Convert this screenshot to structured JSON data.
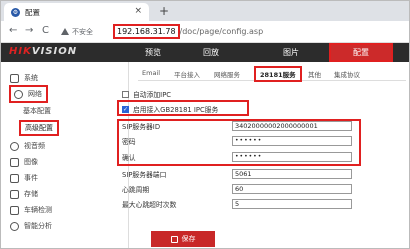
{
  "browser": {
    "tab_title": "配置",
    "tab_close": "×",
    "new_tab": "+",
    "back": "←",
    "forward": "→",
    "reload": "C",
    "security_label": "不安全",
    "url_host": "192.168.31.78",
    "url_path": "/doc/page/config.asp"
  },
  "topnav": {
    "logo_prefix": "HIK",
    "logo_suffix": "VISION",
    "items": [
      "预览",
      "回放",
      "图片",
      "配置"
    ]
  },
  "sidebar": {
    "items": [
      "系统",
      "网络",
      "视音频",
      "图像",
      "事件",
      "存储",
      "车辆检测",
      "智能分析"
    ],
    "sub_items": [
      "基本配置",
      "高级配置"
    ]
  },
  "tabs": [
    "Email",
    "平台接入",
    "网络服务",
    "28181服务",
    "其他",
    "集成协议"
  ],
  "form": {
    "auto_add_label": "自动添加IPC",
    "enable_label": "启用接入GB28181 IPC服务",
    "enable_checked": true,
    "fields": [
      {
        "label": "SIP服务器ID",
        "value": "34020000002000000001"
      },
      {
        "label": "密码",
        "value": "••••••"
      },
      {
        "label": "确认",
        "value": "••••••"
      },
      {
        "label": "SIP服务器端口",
        "value": "5061"
      },
      {
        "label": "心跳周期",
        "value": "60"
      },
      {
        "label": "最大心跳超时次数",
        "value": "5"
      }
    ],
    "save_label": "保存"
  },
  "colors": {
    "accent": "#cc2a2a",
    "highlight": "#e02020",
    "nav_bg": "#2c2c2c"
  }
}
